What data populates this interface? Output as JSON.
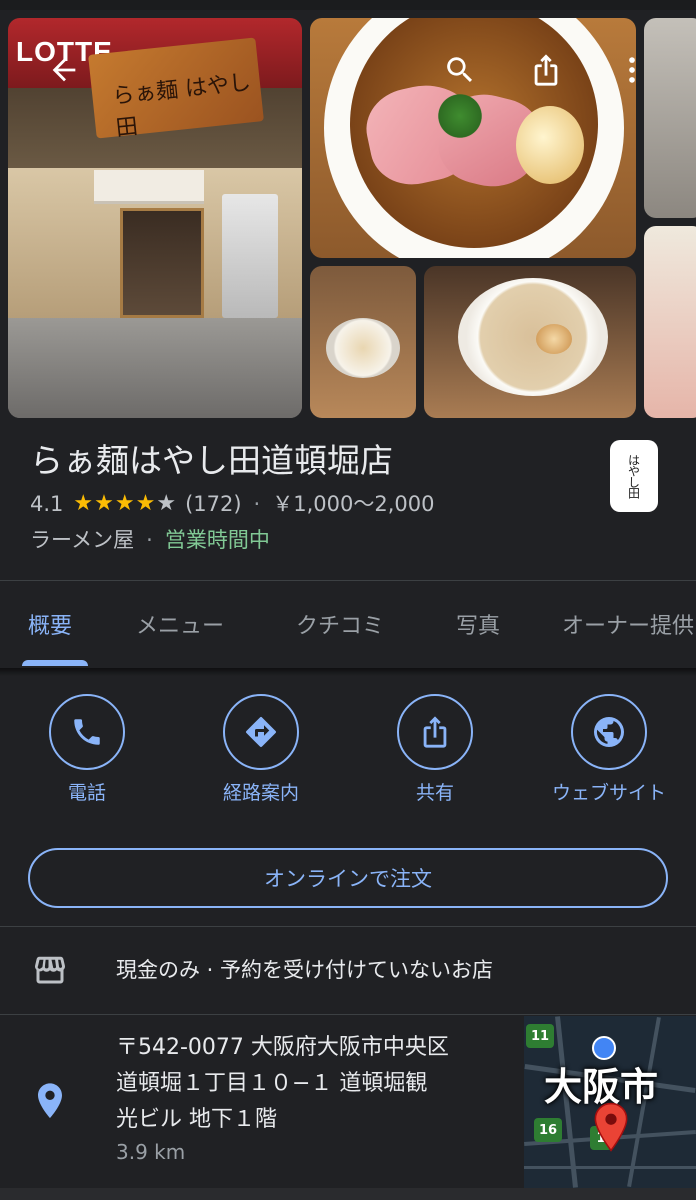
{
  "place": {
    "name": "らぁ麺はやし田道頓堀店",
    "rating": "4.1",
    "stars_filled": 4,
    "stars_total": 5,
    "review_count": "(172)",
    "price_range": "￥1,000〜2,000",
    "category": "ラーメン屋",
    "open_status": "営業時間中",
    "separator": "·"
  },
  "gallery": {
    "photo_sign_text": "LOTTE",
    "board_text": "らぁ麺 はやし田"
  },
  "tabs": [
    {
      "label": "概要",
      "active": true
    },
    {
      "label": "メニュー",
      "active": false
    },
    {
      "label": "クチコミ",
      "active": false
    },
    {
      "label": "写真",
      "active": false
    },
    {
      "label": "オーナー提供",
      "active": false
    }
  ],
  "actions": [
    {
      "label": "電話",
      "icon": "phone-icon"
    },
    {
      "label": "経路案内",
      "icon": "directions-icon"
    },
    {
      "label": "共有",
      "icon": "share-icon"
    },
    {
      "label": "ウェブサイト",
      "icon": "globe-icon"
    }
  ],
  "order_button": "オンラインで注文",
  "attributes": {
    "icon": "storefront-icon",
    "text": "現金のみ · 予約を受け付けていないお店"
  },
  "address": {
    "icon": "pin-icon",
    "lines": [
      "〒542-0077 大阪府大阪市中央区",
      "道頓堀１丁目１０−１ 道頓堀観",
      "光ビル 地下１階"
    ],
    "distance": "3.9 km"
  },
  "map": {
    "city_label": "大阪市",
    "route_shields": [
      "11",
      "16",
      "1"
    ]
  },
  "logo_text": "はやし田",
  "colors": {
    "background": "#202124",
    "accent": "#8ab4f8",
    "star": "#fbbc04",
    "open": "#81c995",
    "text_primary": "#e8eaed",
    "text_secondary": "#bdc1c6"
  }
}
